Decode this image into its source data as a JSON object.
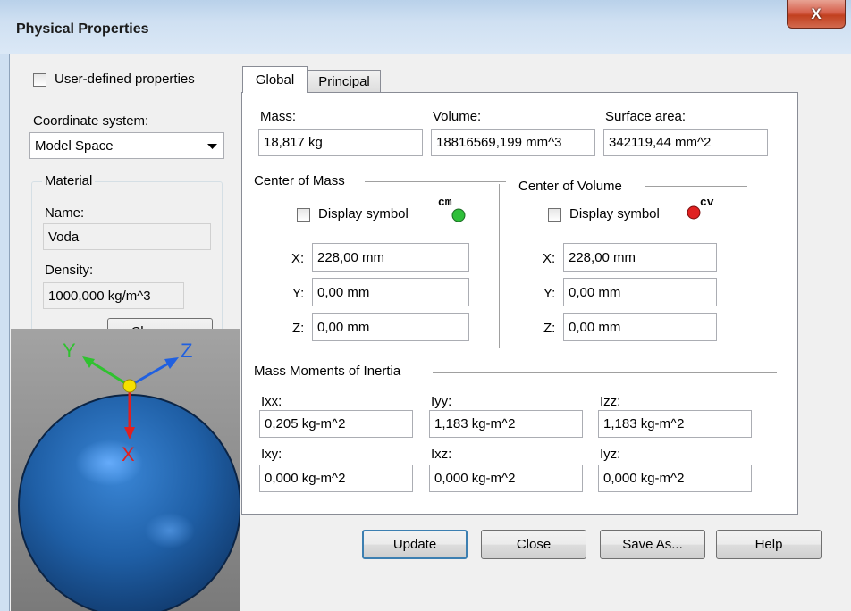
{
  "window": {
    "title": "Physical Properties",
    "close_glyph": "X"
  },
  "left_panel": {
    "user_defined_label": "User-defined properties",
    "coordinate_system_label": "Coordinate system:",
    "coordinate_system_value": "Model Space",
    "material_group": "Material",
    "name_label": "Name:",
    "name_value": "Voda",
    "density_label": "Density:",
    "density_value": "1000,000 kg/m^3",
    "change_button": "Change..."
  },
  "preview": {
    "axis_x": "X",
    "axis_y": "Y",
    "axis_z": "Z",
    "colors": {
      "background": "#8f8f8f",
      "sphere": "#1f5fa6",
      "x_axis": "#e02020",
      "y_axis": "#2fc22f",
      "z_axis": "#2060e0",
      "origin": "#f5e000"
    }
  },
  "tabs": {
    "global": "Global",
    "principal": "Principal"
  },
  "global": {
    "mass_label": "Mass:",
    "mass_value": "18,817 kg",
    "volume_label": "Volume:",
    "volume_value": "18816569,199 mm^3",
    "surface_label": "Surface area:",
    "surface_value": "342119,44 mm^2",
    "center_mass": {
      "title": "Center of Mass",
      "display_symbol": "Display symbol",
      "symbol_text": "cm",
      "symbol_color": "#2fbf3a",
      "x_label": "X:",
      "x_value": "228,00 mm",
      "y_label": "Y:",
      "y_value": "0,00 mm",
      "z_label": "Z:",
      "z_value": "0,00 mm"
    },
    "center_volume": {
      "title": "Center of Volume",
      "display_symbol": "Display symbol",
      "symbol_text": "cv",
      "symbol_color": "#e02020",
      "x_label": "X:",
      "x_value": "228,00 mm",
      "y_label": "Y:",
      "y_value": "0,00 mm",
      "z_label": "Z:",
      "z_value": "0,00 mm"
    },
    "inertia": {
      "title": "Mass Moments of Inertia",
      "ixx_label": "Ixx:",
      "ixx_value": "0,205 kg-m^2",
      "iyy_label": "Iyy:",
      "iyy_value": "1,183 kg-m^2",
      "izz_label": "Izz:",
      "izz_value": "1,183 kg-m^2",
      "ixy_label": "Ixy:",
      "ixy_value": "0,000 kg-m^2",
      "ixz_label": "Ixz:",
      "ixz_value": "0,000 kg-m^2",
      "iyz_label": "Iyz:",
      "iyz_value": "0,000 kg-m^2"
    }
  },
  "buttons": {
    "update": "Update",
    "close": "Close",
    "save_as": "Save As...",
    "help": "Help"
  }
}
